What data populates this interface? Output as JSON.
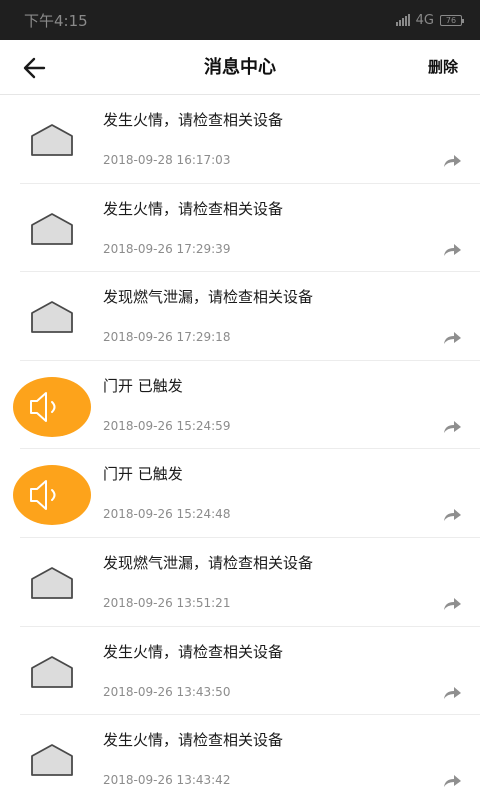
{
  "status_bar": {
    "time": "下午4:15",
    "network": "4G",
    "battery": "76"
  },
  "header": {
    "title": "消息中心",
    "delete_label": "删除"
  },
  "messages": [
    {
      "icon": "house-icon",
      "text": "发生火情，请检查相关设备",
      "time": "2018-09-28 16:17:03"
    },
    {
      "icon": "house-icon",
      "text": "发生火情，请检查相关设备",
      "time": "2018-09-26 17:29:39"
    },
    {
      "icon": "house-icon",
      "text": "发现燃气泄漏，请检查相关设备",
      "time": "2018-09-26 17:29:18"
    },
    {
      "icon": "alarm-speaker-icon",
      "text": "门开 已触发",
      "time": "2018-09-26 15:24:59"
    },
    {
      "icon": "alarm-speaker-icon",
      "text": "门开 已触发",
      "time": "2018-09-26 15:24:48"
    },
    {
      "icon": "house-icon",
      "text": "发现燃气泄漏，请检查相关设备",
      "time": "2018-09-26 13:51:21"
    },
    {
      "icon": "house-icon",
      "text": "发生火情，请检查相关设备",
      "time": "2018-09-26 13:43:50"
    },
    {
      "icon": "house-icon",
      "text": "发生火情，请检查相关设备",
      "time": "2018-09-26 13:43:42"
    }
  ],
  "colors": {
    "alarm_orange": "#FDA31B",
    "house_fill": "#DCDCDC"
  }
}
